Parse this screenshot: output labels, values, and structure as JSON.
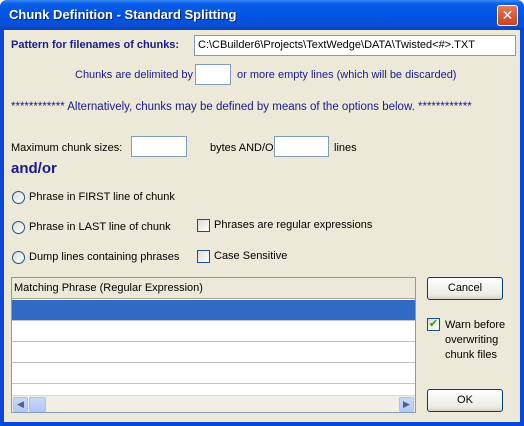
{
  "window": {
    "title": "Chunk Definition - Standard Splitting",
    "close_glyph": "✕"
  },
  "pattern": {
    "label": "Pattern for filenames of chunks:",
    "value": "C:\\CBuilder6\\Projects\\TextWedge\\DATA\\Twisted<#>.TXT"
  },
  "delimiter": {
    "prefix": "Chunks are delimited by",
    "value": "",
    "suffix": "or more empty lines (which will be discarded)"
  },
  "alternatively_text": "************  Alternatively, chunks may be defined by means of the options below.  ************",
  "max_sizes": {
    "label": "Maximum chunk sizes:",
    "bytes_value": "",
    "bytes_label": "bytes  AND/OR",
    "lines_value": "",
    "lines_label": "lines"
  },
  "andor_label": "and/or",
  "radios": {
    "first": "Phrase in FIRST line of chunk",
    "last": "Phrase in LAST line of chunk",
    "dump": "Dump lines containing phrases"
  },
  "checks": {
    "regular": "Phrases are regular expressions",
    "case": "Case Sensitive",
    "warn_line1": "Warn before",
    "warn_line2": "overwriting",
    "warn_line3": "chunk files",
    "warn_checked_glyph": "✔"
  },
  "grid": {
    "header": "Matching Phrase (Regular Expression)",
    "rows": [
      "",
      "",
      "",
      "",
      ""
    ]
  },
  "scroll": {
    "left": "◀",
    "right": "▶"
  },
  "buttons": {
    "cancel": "Cancel",
    "ok": "OK"
  }
}
